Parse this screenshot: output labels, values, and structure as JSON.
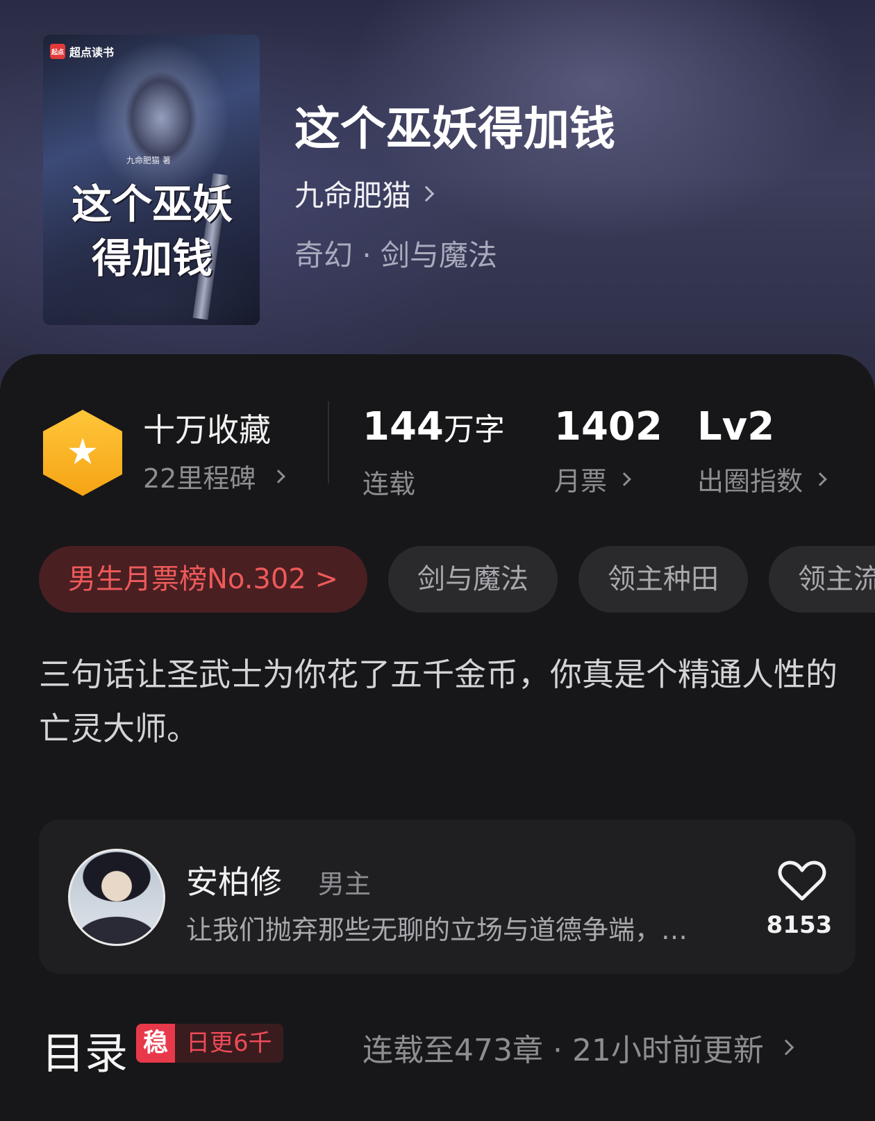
{
  "book": {
    "cover_brand": "超点读书",
    "cover_author_small": "九命肥猫 著",
    "cover_title": "这个巫妖得加钱",
    "title": "这个巫妖得加钱",
    "author": "九命肥猫",
    "genre": "奇幻 · 剑与魔法"
  },
  "stats": {
    "collect": {
      "title": "十万收藏",
      "milestone": "22里程碑"
    },
    "words": {
      "value": "144",
      "unit": "万字",
      "label": "连载"
    },
    "tickets": {
      "value": "1402",
      "label": "月票"
    },
    "index": {
      "value": "Lv2",
      "label": "出圈指数"
    }
  },
  "tags": [
    {
      "label": "男生月票榜No.302 >"
    },
    {
      "label": "剑与魔法"
    },
    {
      "label": "领主种田"
    },
    {
      "label": "领主流"
    }
  ],
  "synopsis": "三句话让圣武士为你花了五千金币，你真是个精通人性的亡灵大师。",
  "character": {
    "name": "安柏修",
    "role": "男主",
    "quote": "让我们抛弃那些无聊的立场与道德争端，…",
    "likes": "8153"
  },
  "toc": {
    "title": "目录",
    "badge_key": "稳",
    "badge_value": "日更6千",
    "info": "连载至473章 · 21小时前更新"
  },
  "colors": {
    "accent_red": "#ee5a5a",
    "badge_gold": "#f5a414",
    "background": "#171719"
  }
}
